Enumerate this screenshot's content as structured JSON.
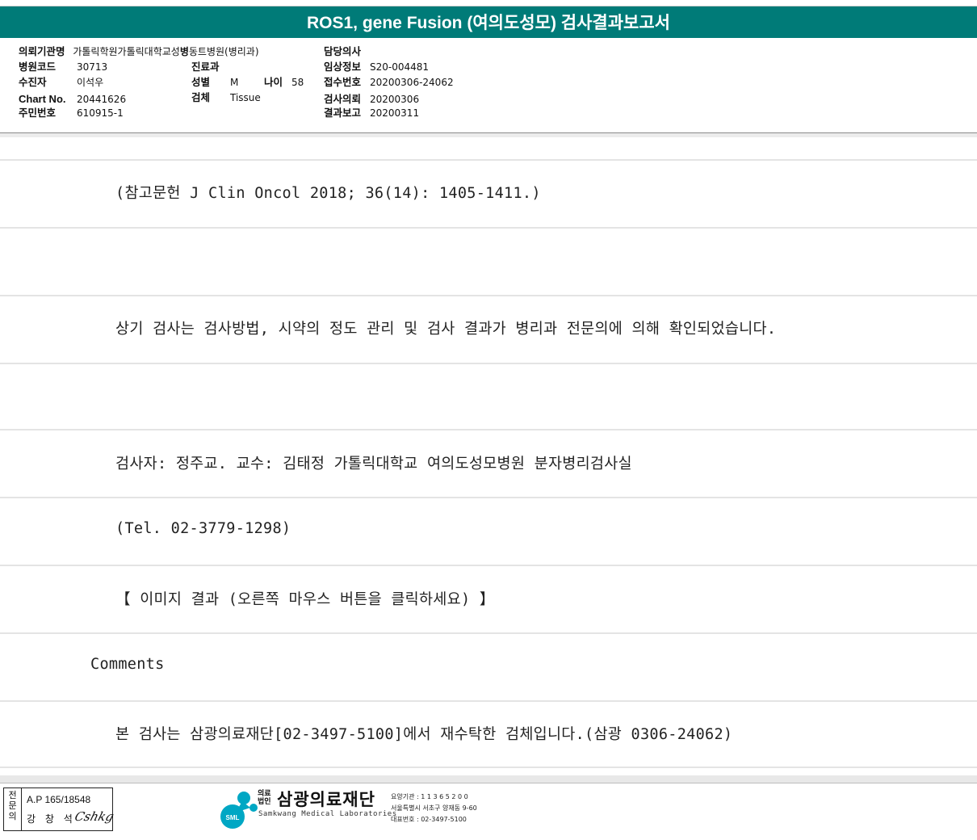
{
  "report": {
    "title": "ROS1, gene Fusion (여의도성모) 검사결과보고서"
  },
  "patient_info": {
    "institution_label": "의뢰기관명",
    "institution_value": "가톨릭학원가톨릭대학교성빈센트병원(병리과)",
    "institution_value_a": "가톨릭학원가톨릭대학교성",
    "institution_value_b": "병",
    "institution_value_c": "동트병원(병리과)",
    "hospital_code_label": "병원코드",
    "hospital_code_value": "30713",
    "dept_label": "진료과",
    "dept_value": "",
    "examinee_label": "수진자",
    "examinee_value": "이석우",
    "sex_label": "성별",
    "sex_value": "M",
    "age_label": "나이",
    "age_value": "58",
    "chart_label": "Chart No.",
    "chart_value": "20441626",
    "specimen_label": "검체",
    "specimen_value": "Tissue",
    "resident_label": "주민번호",
    "resident_value": "610915-1",
    "doctor_label": "담당의사",
    "doctor_value": "",
    "clinical_label": "임상정보",
    "clinical_value": "S20-004481",
    "receipt_label": "접수번호",
    "receipt_value": "20200306-24062",
    "request_label": "검사의뢰",
    "request_value": "20200306",
    "result_label": "결과보고",
    "result_value": "20200311"
  },
  "body": {
    "reference": "(참고문헌 J Clin Oncol 2018; 36(14): 1405-1411.)",
    "statement": "상기 검사는 검사방법, 시약의 정도 관리 및 검사 결과가 병리과 전문의에 의해 확인되었습니다.",
    "examiners": "검사자: 정주교. 교수: 김태정 가톨릭대학교 여의도성모병원 분자병리검사실",
    "tel": "(Tel. 02-3779-1298)",
    "image_result": "【 이미지 결과 (오른쪽 마우스 버튼을 클릭하세요) 】",
    "comments_label": "Comments",
    "comment": "본 검사는 삼광의료재단[02-3497-5100]에서 재수탁한 검체입니다.(삼광 0306-24062)"
  },
  "footer": {
    "stamp_side": "전문의",
    "stamp_ap": "A.P 165/18548",
    "stamp_name": "강 창 석",
    "stamp_sign": "Cshkg",
    "logo_badge": "SML",
    "logo_small_1": "의료",
    "logo_small_2": "법인",
    "logo_name": "삼광의료재단",
    "logo_en": "Samkwang Medical Laboratories",
    "info_1": "요양기관 : 1 1 3 6 5 2 0 0",
    "info_2": "서울특별시 서초구 양재동 9-60",
    "info_3": "대표번호 : 02-3497-5100",
    "colors": {
      "header": "#007b78",
      "logo": "#00a7c4"
    }
  }
}
